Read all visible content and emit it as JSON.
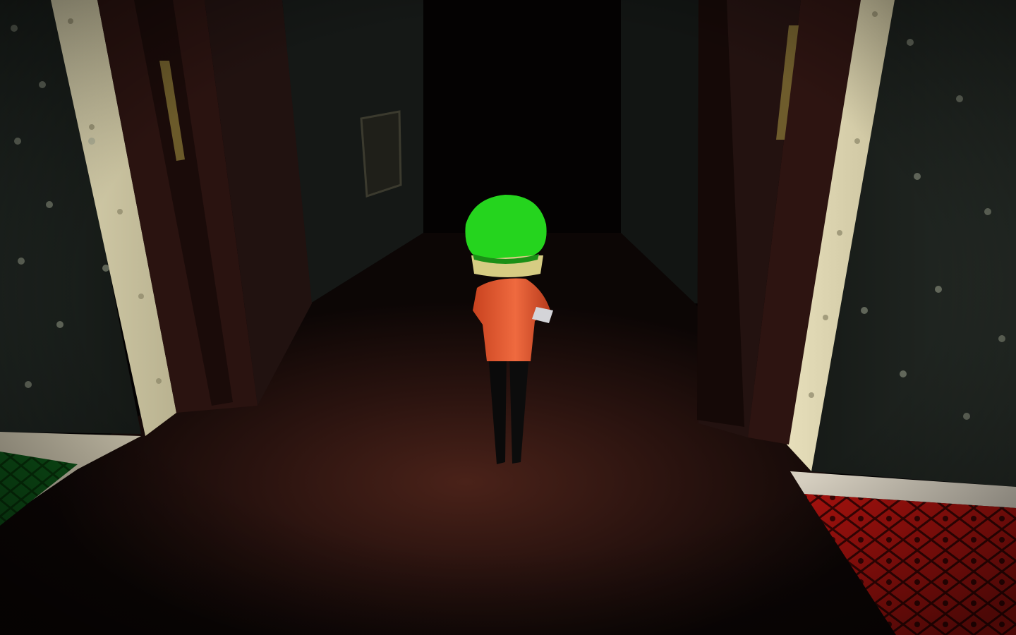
{
  "scene": {
    "description_free": true,
    "palette": {
      "wall_dark": "#1c221f",
      "wallpaper_light": "#cfc8a6",
      "door_frame": "#2b1512",
      "floor": "#2a1410",
      "hat_green": "#22d21c",
      "hair_blonde": "#d9cf86",
      "hoodie_orange": "#e0502f",
      "pants_black": "#0b0b0b",
      "rug_red": "#b8140f",
      "rug_green": "#0e5a1a"
    },
    "character": {
      "hat": "green-beanie",
      "top": "orange-hoodie",
      "legs": "black-pants"
    }
  }
}
